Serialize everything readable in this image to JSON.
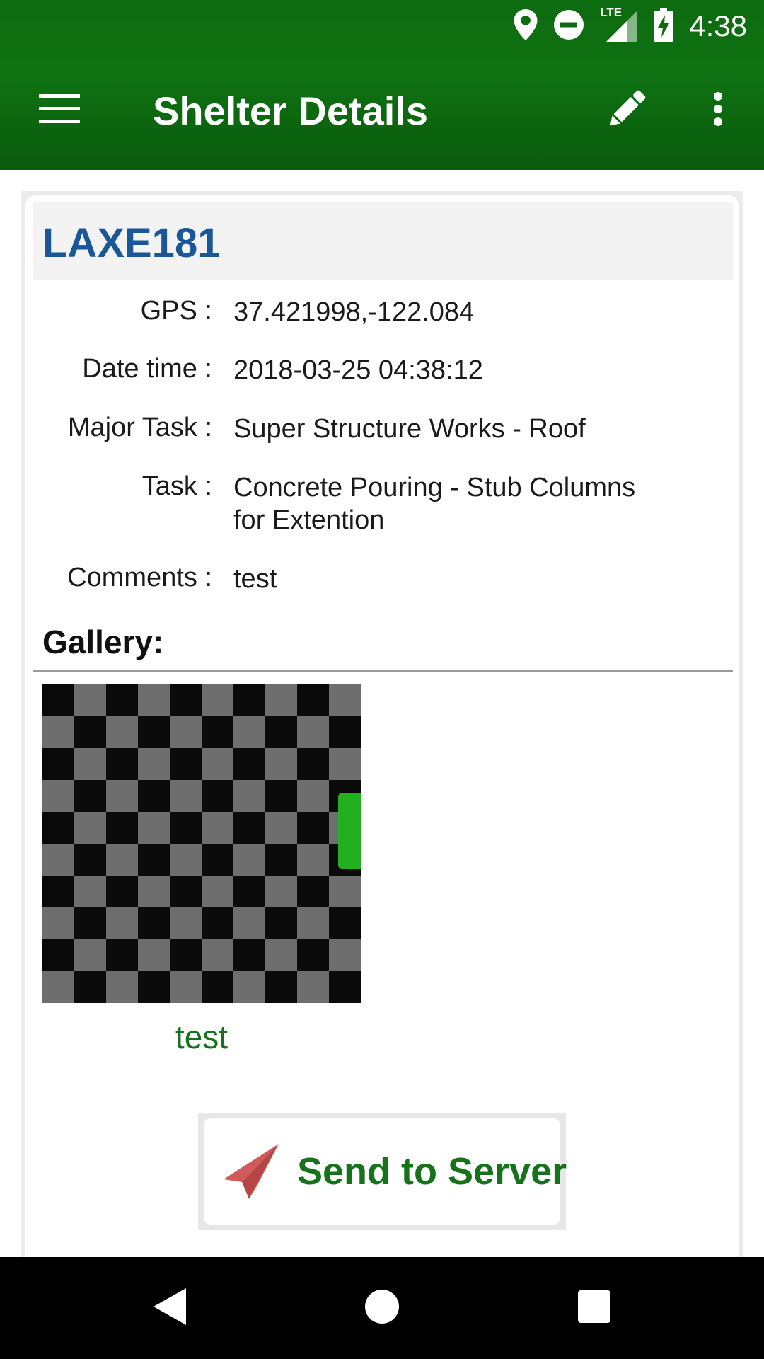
{
  "status_bar": {
    "time": "4:38",
    "network_label": "LTE",
    "icons": [
      "location-icon",
      "do-not-disturb-icon",
      "lte-signal-icon",
      "battery-charging-icon"
    ]
  },
  "toolbar": {
    "title": "Shelter Details",
    "icons": [
      "menu-icon",
      "edit-pencil-icon",
      "more-vert-icon"
    ]
  },
  "shelter": {
    "id": "LAXE181",
    "details": [
      {
        "label": "GPS :",
        "value": "37.421998,-122.084"
      },
      {
        "label": "Date time :",
        "value": "2018-03-25 04:38:12"
      },
      {
        "label": "Major Task :",
        "value": "Super Structure Works - Roof"
      },
      {
        "label": "Task :",
        "value": "Concrete Pouring - Stub Columns for Extention"
      },
      {
        "label": "Comments :",
        "value": "test"
      }
    ]
  },
  "gallery": {
    "heading": "Gallery:",
    "items": [
      {
        "caption": "test"
      }
    ]
  },
  "actions": {
    "send_label": "Send to Server",
    "send_icon": "paper-plane-icon"
  },
  "colors": {
    "appbar": "#0f7212",
    "shelter_id": "#1b5797",
    "accent_green": "#16731b",
    "send_icon": "#d05a5a"
  },
  "nav_bar": {
    "icons": [
      "back-icon",
      "home-icon",
      "recents-icon"
    ]
  }
}
